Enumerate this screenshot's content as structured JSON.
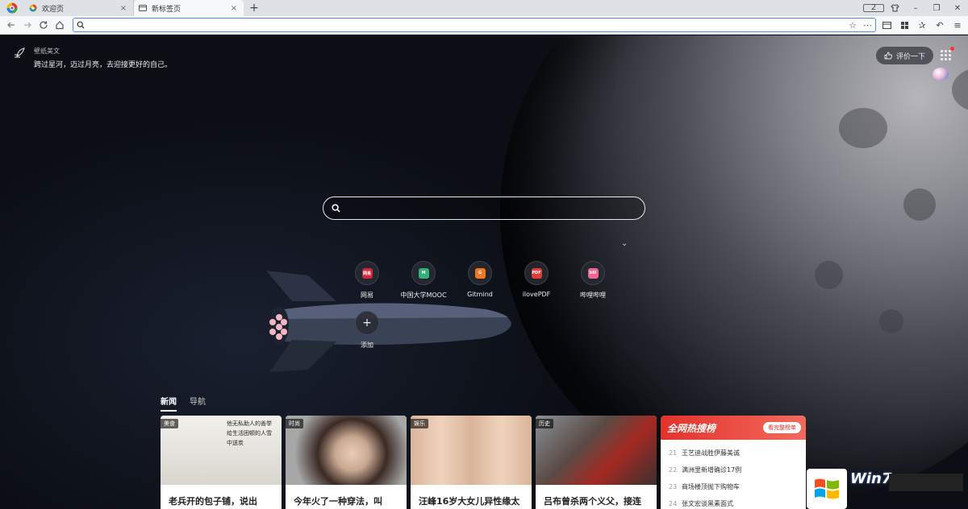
{
  "tabs": [
    {
      "title": "欢迎页",
      "close": "×",
      "active": false
    },
    {
      "title": "新标签页",
      "close": "×",
      "active": true
    }
  ],
  "newtab_label": "+",
  "window_controls": {
    "tab_count": "2"
  },
  "address_bar": {
    "value": "",
    "placeholder": ""
  },
  "wallpaper": {
    "label": "壁纸美文",
    "quote": "跨过星河，迈过月亮，去迎接更好的自己。"
  },
  "rate_button": {
    "label": "评价一下"
  },
  "search": {
    "placeholder": ""
  },
  "quick_links": [
    {
      "name": "网易",
      "badge": "网易",
      "color": "#d0283a"
    },
    {
      "name": "中国大学MOOC",
      "badge": "M",
      "color": "#33b07a"
    },
    {
      "name": "Gitmind",
      "badge": "G",
      "color": "#f07a24"
    },
    {
      "name": "ilovePDF",
      "badge": "PDF",
      "color": "#e23b3b"
    },
    {
      "name": "哔哩哔哩",
      "badge": "bili",
      "color": "#f2678f"
    }
  ],
  "add_link": {
    "name": "添加",
    "icon": "+"
  },
  "news_tabs": [
    {
      "label": "新闻",
      "active": true
    },
    {
      "label": "导航",
      "active": false
    }
  ],
  "news_cards": [
    {
      "tag": "美食",
      "title": "老兵开的包子铺，说出",
      "thumb_text": "他无私助人的善举给生活困顿的人雪中送炭"
    },
    {
      "tag": "时尚",
      "title": "今年火了一种穿法，叫",
      "thumb_text": ""
    },
    {
      "tag": "娱乐",
      "title": "汪峰16岁大女儿异性缘太",
      "thumb_text": ""
    },
    {
      "tag": "历史",
      "title": "吕布曾杀两个义父，接连",
      "thumb_text": ""
    }
  ],
  "hot_list": {
    "title": "全网热搜榜",
    "view_all": "看完整榜单",
    "items": [
      {
        "rank": "21",
        "text": "王艺迪战胜伊藤美诚"
      },
      {
        "rank": "22",
        "text": "满洲里新增确诊17例"
      },
      {
        "rank": "23",
        "text": "商场楼顶抛下购物车"
      },
      {
        "rank": "24",
        "text": "张文宏谈黑素面式"
      }
    ]
  },
  "watermark": {
    "text": "Win7"
  },
  "colors": {
    "accent": "#4a8cf0",
    "hot_red": "#e4322c"
  }
}
